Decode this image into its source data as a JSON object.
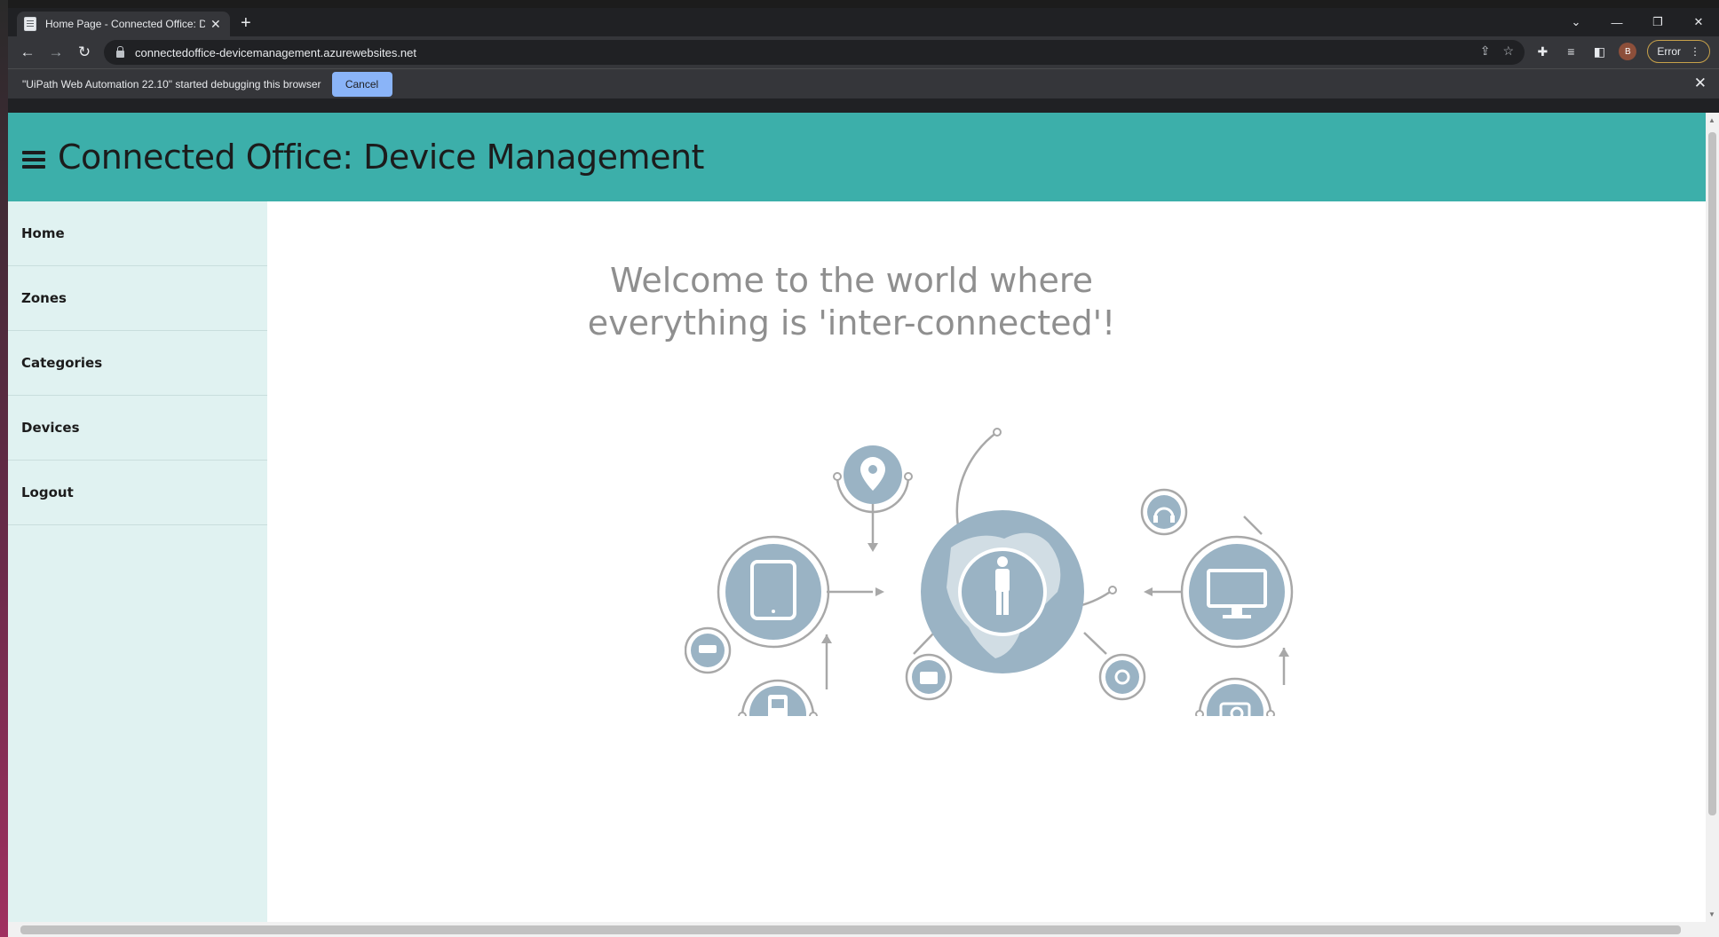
{
  "browser": {
    "tab_title": "Home Page - Connected Office: D",
    "new_tab": "+",
    "url": "connectedoffice-devicemanagement.azurewebsites.net",
    "profile_initial": "B",
    "error_label": "Error"
  },
  "debug_bar": {
    "message": "\"UiPath Web Automation 22.10\" started debugging this browser",
    "cancel_label": "Cancel"
  },
  "app": {
    "title": "Connected Office: Device Management",
    "accent_color": "#3cafaa",
    "sidebar_color": "#e0f2f1"
  },
  "sidebar": {
    "items": [
      {
        "label": "Home"
      },
      {
        "label": "Zones"
      },
      {
        "label": "Categories"
      },
      {
        "label": "Devices"
      },
      {
        "label": "Logout"
      }
    ]
  },
  "main": {
    "welcome_line1": "Welcome to the world where",
    "welcome_line2": "everything is 'inter-connected'!",
    "illustration_icons": [
      "location-pin-icon",
      "tablet-icon",
      "cctv-camera-icon",
      "mobile-phone-icon",
      "globe-person-icon",
      "tv-icon",
      "watch-icon",
      "headphones-icon",
      "monitor-icon",
      "camera-icon"
    ]
  }
}
